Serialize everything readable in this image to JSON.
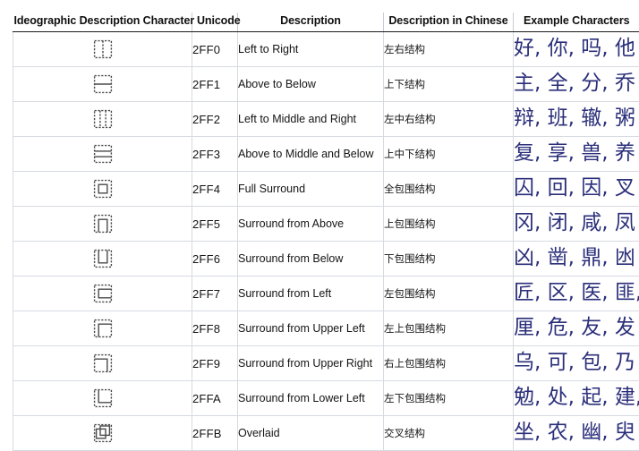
{
  "table": {
    "headers": [
      "Ideographic Description Character",
      "Unicode",
      "Description",
      "Description in Chinese",
      "Example Characters"
    ],
    "rows": [
      {
        "glyph": "⿰",
        "glyph_name": "idc-left-to-right",
        "unicode": "2FF0",
        "description": "Left to Right",
        "description_cn": "左右结构",
        "examples": "好, 你, 吗, 他"
      },
      {
        "glyph": "⿱",
        "glyph_name": "idc-above-to-below",
        "unicode": "2FF1",
        "description": "Above to Below",
        "description_cn": "上下结构",
        "examples": "主, 全, 分, 乔"
      },
      {
        "glyph": "⿲",
        "glyph_name": "idc-left-to-middle-and-right",
        "unicode": "2FF2",
        "description": "Left to Middle and Right",
        "description_cn": "左中右结构",
        "examples": "辩, 班, 辙, 粥"
      },
      {
        "glyph": "⿳",
        "glyph_name": "idc-above-to-middle-and-below",
        "unicode": "2FF3",
        "description": "Above to Middle and Below",
        "description_cn": "上中下结构",
        "examples": "复, 享, 兽, 养"
      },
      {
        "glyph": "⿴",
        "glyph_name": "idc-full-surround",
        "unicode": "2FF4",
        "description": "Full Surround",
        "description_cn": "全包围结构",
        "examples": "囚, 回, 因, 叉"
      },
      {
        "glyph": "⿵",
        "glyph_name": "idc-surround-from-above",
        "unicode": "2FF5",
        "description": "Surround from Above",
        "description_cn": "上包围结构",
        "examples": "冈, 闭, 咸, 凤"
      },
      {
        "glyph": "⿶",
        "glyph_name": "idc-surround-from-below",
        "unicode": "2FF6",
        "description": "Surround from Below",
        "description_cn": "下包围结构",
        "examples": "凶, 凿, 鼎, 凼"
      },
      {
        "glyph": "⿷",
        "glyph_name": "idc-surround-from-left",
        "unicode": "2FF7",
        "description": "Surround from Left",
        "description_cn": "左包围结构",
        "examples": "匠, 区, 医, 匪,"
      },
      {
        "glyph": "⿸",
        "glyph_name": "idc-surround-from-upper-left",
        "unicode": "2FF8",
        "description": "Surround from Upper Left",
        "description_cn": "左上包围结构",
        "examples": "厘, 危, 友, 发"
      },
      {
        "glyph": "⿹",
        "glyph_name": "idc-surround-from-upper-right",
        "unicode": "2FF9",
        "description": "Surround from Upper Right",
        "description_cn": "右上包围结构",
        "examples": "乌, 可, 包, 乃"
      },
      {
        "glyph": "⿺",
        "glyph_name": "idc-surround-from-lower-left",
        "unicode": "2FFA",
        "description": "Surround from Lower Left",
        "description_cn": "左下包围结构",
        "examples": "勉, 处, 起, 建,"
      },
      {
        "glyph": "⿻",
        "glyph_name": "idc-overlaid",
        "unicode": "2FFB",
        "description": "Overlaid",
        "description_cn": "交叉结构",
        "examples": "坐, 农, 幽, 臾"
      }
    ]
  },
  "colors": {
    "example_text": "#2b2f7a",
    "header_text": "#0f0f0f",
    "grid_line": "#d6dae1",
    "header_rule": "#1a1a1a",
    "background": "#ffffff"
  }
}
